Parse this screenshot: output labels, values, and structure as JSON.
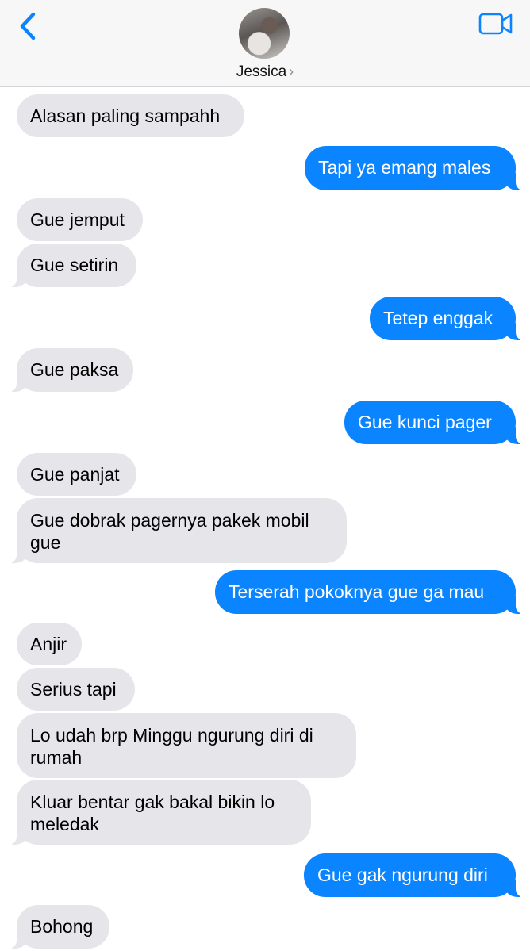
{
  "header": {
    "contact_name": "Jessica",
    "chevron": "›",
    "back_icon": "chevron-left-icon",
    "video_icon": "video-camera-icon",
    "accent_color": "#0b84ff"
  },
  "messages": [
    {
      "from": "them",
      "text": "Alasan paling sampahh"
    },
    {
      "from": "me",
      "text": "Tapi ya emang males"
    },
    {
      "from": "them",
      "text": "Gue jemput"
    },
    {
      "from": "them",
      "text": "Gue setirin"
    },
    {
      "from": "me",
      "text": "Tetep enggak"
    },
    {
      "from": "them",
      "text": "Gue paksa"
    },
    {
      "from": "me",
      "text": "Gue kunci pager"
    },
    {
      "from": "them",
      "text": "Gue panjat"
    },
    {
      "from": "them",
      "text": "Gue dobrak pagernya pakek mobil gue"
    },
    {
      "from": "me",
      "text": "Terserah pokoknya gue ga mau"
    },
    {
      "from": "them",
      "text": "Anjir"
    },
    {
      "from": "them",
      "text": "Serius tapi"
    },
    {
      "from": "them",
      "text": "Lo udah brp Minggu ngurung diri di rumah"
    },
    {
      "from": "them",
      "text": "Kluar bentar gak bakal bikin lo meledak"
    },
    {
      "from": "me",
      "text": "Gue gak ngurung diri"
    },
    {
      "from": "them",
      "text": "Bohong"
    }
  ]
}
